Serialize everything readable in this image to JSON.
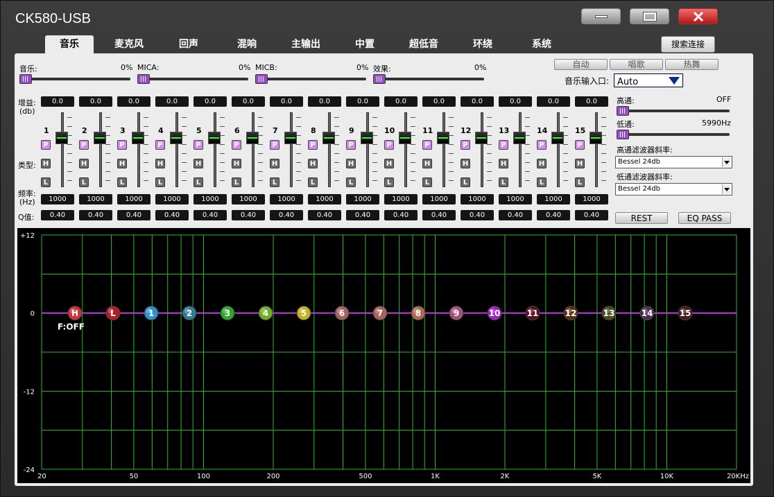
{
  "window": {
    "title": "CK580-USB"
  },
  "tabs": [
    {
      "label": "音乐",
      "active": true
    },
    {
      "label": "麦克风"
    },
    {
      "label": "回声"
    },
    {
      "label": "混响"
    },
    {
      "label": "主输出"
    },
    {
      "label": "中置"
    },
    {
      "label": "超低音"
    },
    {
      "label": "环绕"
    },
    {
      "label": "系统"
    }
  ],
  "search_button": "搜索连接",
  "volumes": [
    {
      "label": "音乐:",
      "value": "0%"
    },
    {
      "label": "MICA:",
      "value": "0%"
    },
    {
      "label": "MICB:",
      "value": "0%"
    },
    {
      "label": "效果:",
      "value": "0%"
    }
  ],
  "presets": [
    "自动",
    "唱歌",
    "热舞"
  ],
  "music_input": {
    "label": "音乐输入口:",
    "value": "Auto"
  },
  "row_labels": {
    "gain_1": "增益:",
    "gain_2": "(db)",
    "type": "类型:",
    "freq_1": "频率:",
    "freq_2": "(Hz)",
    "q": "Q值:"
  },
  "bands": [
    {
      "num": "1",
      "gain": "0.0",
      "freq": "1000",
      "q": "0.40"
    },
    {
      "num": "2",
      "gain": "0.0",
      "freq": "1000",
      "q": "0.40"
    },
    {
      "num": "3",
      "gain": "0.0",
      "freq": "1000",
      "q": "0.40"
    },
    {
      "num": "4",
      "gain": "0.0",
      "freq": "1000",
      "q": "0.40"
    },
    {
      "num": "5",
      "gain": "0.0",
      "freq": "1000",
      "q": "0.40"
    },
    {
      "num": "6",
      "gain": "0.0",
      "freq": "1000",
      "q": "0.40"
    },
    {
      "num": "7",
      "gain": "0.0",
      "freq": "1000",
      "q": "0.40"
    },
    {
      "num": "8",
      "gain": "0.0",
      "freq": "1000",
      "q": "0.40"
    },
    {
      "num": "9",
      "gain": "0.0",
      "freq": "1000",
      "q": "0.40"
    },
    {
      "num": "10",
      "gain": "0.0",
      "freq": "1000",
      "q": "0.40"
    },
    {
      "num": "11",
      "gain": "0.0",
      "freq": "1000",
      "q": "0.40"
    },
    {
      "num": "12",
      "gain": "0.0",
      "freq": "1000",
      "q": "0.40"
    },
    {
      "num": "13",
      "gain": "0.0",
      "freq": "1000",
      "q": "0.40"
    },
    {
      "num": "14",
      "gain": "0.0",
      "freq": "1000",
      "q": "0.40"
    },
    {
      "num": "15",
      "gain": "0.0",
      "freq": "1000",
      "q": "0.40"
    }
  ],
  "type_buttons": [
    "P",
    "H",
    "L"
  ],
  "highpass": {
    "label": "高通:",
    "value": "OFF"
  },
  "lowpass": {
    "label": "低通:",
    "value": "5990Hz"
  },
  "hp_slope": {
    "label": "高通滤波器斜率:",
    "value": "Bessel 24db"
  },
  "lp_slope": {
    "label": "低通滤波器斜率:",
    "value": "Bessel 24db"
  },
  "rest_button": "REST",
  "eqpass_button": "EQ PASS",
  "graph": {
    "y_ticks": [
      "+12",
      "0",
      "-12",
      "-24"
    ],
    "x_ticks": [
      "20",
      "50",
      "100",
      "200",
      "500",
      "1K",
      "2K",
      "5K",
      "10K",
      "20KHz"
    ],
    "f_status": "F:OFF",
    "markers": [
      {
        "label": "H",
        "color": "#d0303a"
      },
      {
        "label": "L",
        "color": "#b01e28"
      },
      {
        "label": "1",
        "color": "#2e8fd0"
      },
      {
        "label": "2",
        "color": "#2b7f96"
      },
      {
        "label": "3",
        "color": "#2aa82a"
      },
      {
        "label": "4",
        "color": "#6fae20"
      },
      {
        "label": "5",
        "color": "#c4b21a"
      },
      {
        "label": "6",
        "color": "#a86060"
      },
      {
        "label": "7",
        "color": "#a86060"
      },
      {
        "label": "8",
        "color": "#b06a50"
      },
      {
        "label": "9",
        "color": "#a0507a"
      },
      {
        "label": "10",
        "color": "#a020c0"
      },
      {
        "label": "11",
        "color": "#5a1020"
      },
      {
        "label": "12",
        "color": "#5a3010"
      },
      {
        "label": "13",
        "color": "#4a4a20"
      },
      {
        "label": "14",
        "color": "#4a3050"
      },
      {
        "label": "15",
        "color": "#4a1818"
      }
    ]
  }
}
